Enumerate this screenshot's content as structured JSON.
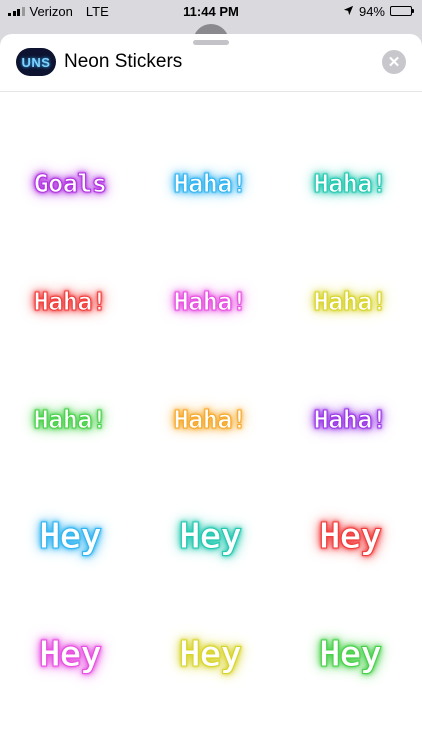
{
  "status_bar": {
    "carrier": "Verizon",
    "network": "LTE",
    "time": "11:44 PM",
    "battery": "94%",
    "battery_level": 0.94
  },
  "header": {
    "app_icon_text": "UNS",
    "title": "Neon Stickers"
  },
  "stickers": [
    {
      "text": "Goals",
      "color": "#b030e0"
    },
    {
      "text": "Haha!",
      "color": "#32b4f0"
    },
    {
      "text": "Haha!",
      "color": "#22c8b0"
    },
    {
      "text": "Haha!",
      "color": "#f03c3c"
    },
    {
      "text": "Haha!",
      "color": "#e64fe0"
    },
    {
      "text": "Haha!",
      "color": "#d8d42c"
    },
    {
      "text": "Haha!",
      "color": "#48d04a"
    },
    {
      "text": "Haha!",
      "color": "#f5a82a"
    },
    {
      "text": "Haha!",
      "color": "#9a36e6"
    },
    {
      "text": "Hey",
      "color": "#32b4f0"
    },
    {
      "text": "Hey",
      "color": "#22c8b0"
    },
    {
      "text": "Hey",
      "color": "#f03c3c"
    },
    {
      "text": "Hey",
      "color": "#e64fe0"
    },
    {
      "text": "Hey",
      "color": "#d8d42c"
    },
    {
      "text": "Hey",
      "color": "#48d04a"
    }
  ]
}
